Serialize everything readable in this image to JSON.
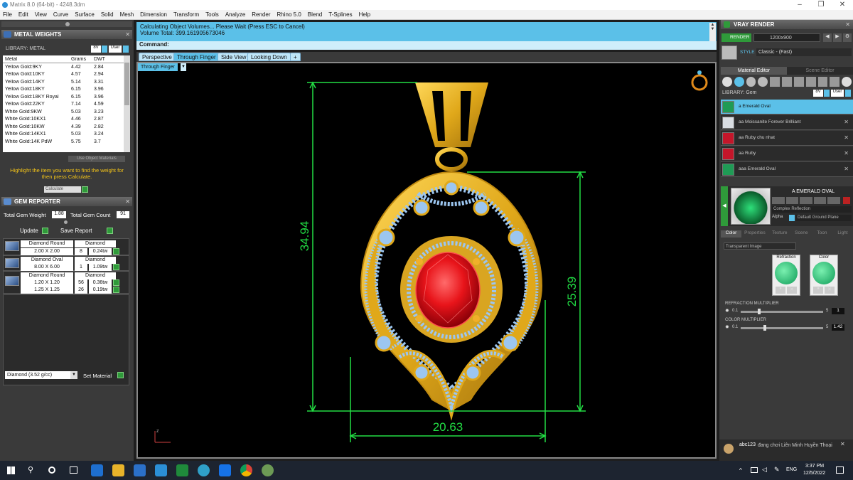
{
  "window": {
    "title": "Matrix 8.0 (64-bit) - 4248.3dm",
    "controls": [
      "–",
      "❐",
      "✕"
    ]
  },
  "menu": [
    "File",
    "Edit",
    "View",
    "Curve",
    "Surface",
    "Solid",
    "Mesh",
    "Dimension",
    "Transform",
    "Tools",
    "Analyze",
    "Render",
    "Rhino 5.0",
    "Blend",
    "T-Splines",
    "Help"
  ],
  "metal_weights": {
    "title": "METAL WEIGHTS",
    "library_label": "LIBRARY: METAL",
    "filters": [
      "8V",
      "User"
    ],
    "columns": [
      "Metal",
      "Grams",
      "DWT"
    ],
    "rows": [
      [
        "Yellow Gold:9KY",
        "4.42",
        "2.84"
      ],
      [
        "Yellow Gold:10KY",
        "4.57",
        "2.94"
      ],
      [
        "Yellow Gold:14KY",
        "5.14",
        "3.31"
      ],
      [
        "Yellow Gold:18KY",
        "6.15",
        "3.96"
      ],
      [
        "Yellow Gold:18KY Royal",
        "6.15",
        "3.96"
      ],
      [
        "Yellow Gold:22KY",
        "7.14",
        "4.59"
      ],
      [
        "White Gold:9KW",
        "5.03",
        "3.23"
      ],
      [
        "White Gold:10KX1",
        "4.46",
        "2.87"
      ],
      [
        "White Gold:10KW",
        "4.39",
        "2.82"
      ],
      [
        "White Gold:14KX1",
        "5.03",
        "3.24"
      ],
      [
        "White Gold:14K PdW",
        "5.75",
        "3.7"
      ]
    ],
    "use_object_materials": "Use Object Materials",
    "instruction": "Highlight the item you want to find the weight for then press Calculate.",
    "calculate_label": "Calculate"
  },
  "gem_reporter": {
    "title": "GEM REPORTER",
    "total_weight_label": "Total Gem Weight",
    "total_weight_value": "1.88",
    "total_count_label": "Total Gem Count",
    "total_count_value": "91",
    "update_label": "Update",
    "save_report_label": "Save Report",
    "groups": [
      {
        "name": "Diamond Round",
        "material": "Diamond",
        "lines": [
          [
            "2.00 X 2.00",
            "8",
            "0.24tw"
          ]
        ]
      },
      {
        "name": "Diamond Oval",
        "material": "Diamond",
        "lines": [
          [
            "8.00 X 6.00",
            "1",
            "1.09tw"
          ]
        ]
      },
      {
        "name": "Diamond Round",
        "material": "Diamond",
        "lines": [
          [
            "1.20 X 1.20",
            "56",
            "0.36tw"
          ],
          [
            "1.25 X 1.25",
            "26",
            "0.19tw"
          ]
        ]
      }
    ],
    "material_select": "Diamond    (3.52 g/cc)",
    "set_material_label": "Set Material"
  },
  "command": {
    "line1": "Calculating Object Volumes... Please Wait (Press ESC to Cancel)",
    "line2": "Volume Total: 399.161905673046",
    "prompt": "Command:"
  },
  "viewport": {
    "tabs": [
      "Perspective",
      "Through Finger",
      "Side View",
      "Looking Down",
      "+"
    ],
    "active_tab": "Through Finger",
    "view_label": "Through Finger",
    "dimensions": {
      "height_total": "34.94",
      "height_body": "25.39",
      "width": "20.63"
    },
    "axis_label": "z",
    "colors": {
      "dimension": "#22dd44",
      "gold": "#e8b320",
      "gem": "#e8141a",
      "stones": "#9cc6f0"
    }
  },
  "vray": {
    "title": "VRAY RENDER",
    "render_label": "RENDER",
    "resolution": "1200x900",
    "style_label": "STYLE",
    "style_value": "Classic - (Fast)",
    "tabs": [
      "Material Editor",
      "Scene Editor"
    ],
    "library_label": "LIBRARY: Gem",
    "filters": [
      "8V",
      "User"
    ],
    "materials": [
      {
        "name": "a Emerald Oval",
        "color": "#1f9b55",
        "selected": true
      },
      {
        "name": "aa Moissanite Forever Brilliant",
        "color": "#d9dde2",
        "selected": false
      },
      {
        "name": "aa Ruby chu nhat",
        "color": "#c4162a",
        "selected": false
      },
      {
        "name": "aa Ruby",
        "color": "#c4162a",
        "selected": false
      },
      {
        "name": "aaa Emerald Oval",
        "color": "#1f9b55",
        "selected": false
      }
    ],
    "preview_name": "A EMERALD OVAL",
    "complex_reflection": "Complex Reflection",
    "alpha_label": "Alpha",
    "ground_plane": "Default Ground Plane",
    "sub_tabs": [
      "Color",
      "Properties",
      "Texture",
      "Scene",
      "Toon",
      "Light"
    ],
    "transparent_image": "Transparent Image",
    "refraction_label": "Refraction",
    "color_label": "Color",
    "refraction_multiplier": {
      "label": "REFRACTION MULTIPLIER",
      "min": "0.1",
      "max": "5",
      "value": "1"
    },
    "color_multiplier": {
      "label": "COLOR MULTIPLIER",
      "min": "0.1",
      "max": "5",
      "value": "1.42"
    }
  },
  "notification": {
    "user": "abc123",
    "message": "đang chơi Liên Minh Huyền Thoại"
  },
  "taskbar": {
    "language": "ENG",
    "time": "3:37 PM",
    "date": "12/5/2022"
  }
}
